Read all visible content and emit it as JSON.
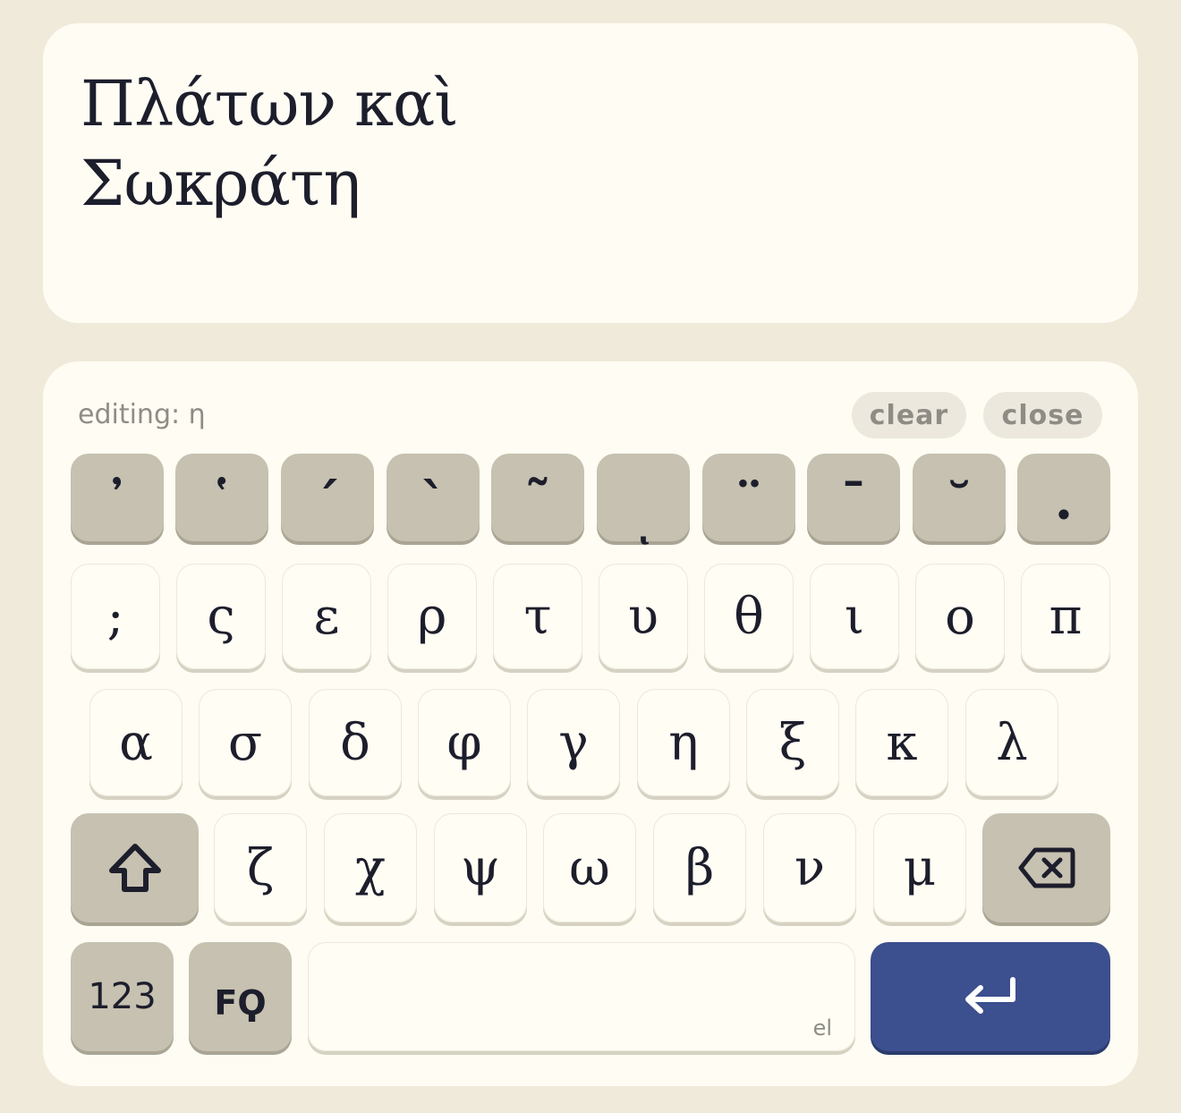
{
  "text": {
    "content": "Πλάτων καὶ\nΣωκράτη"
  },
  "toolbar": {
    "status": "editing: η",
    "clear_label": "clear",
    "close_label": "close"
  },
  "diacritics": [
    "᾿",
    "῾",
    "´",
    "`",
    "῀",
    "ͺ",
    "¨",
    "¯",
    "˘",
    "·"
  ],
  "row1": [
    ";",
    "ς",
    "ε",
    "ρ",
    "τ",
    "υ",
    "θ",
    "ι",
    "ο",
    "π"
  ],
  "row2": [
    "α",
    "σ",
    "δ",
    "φ",
    "γ",
    "η",
    "ξ",
    "κ",
    "λ"
  ],
  "row3": [
    "ζ",
    "χ",
    "ψ",
    "ω",
    "β",
    "ν",
    "μ"
  ],
  "bottom": {
    "numbers_label": "123",
    "lang_label": "FϘ",
    "space_hint": "el"
  },
  "icons": {
    "shift": "shift-icon",
    "backspace": "backspace-icon",
    "enter": "enter-icon"
  },
  "colors": {
    "background": "#f0eadb",
    "card": "#fefcf3",
    "key_dark": "#c6c1b0",
    "enter": "#3c4f8e",
    "text": "#1d1e2c"
  }
}
